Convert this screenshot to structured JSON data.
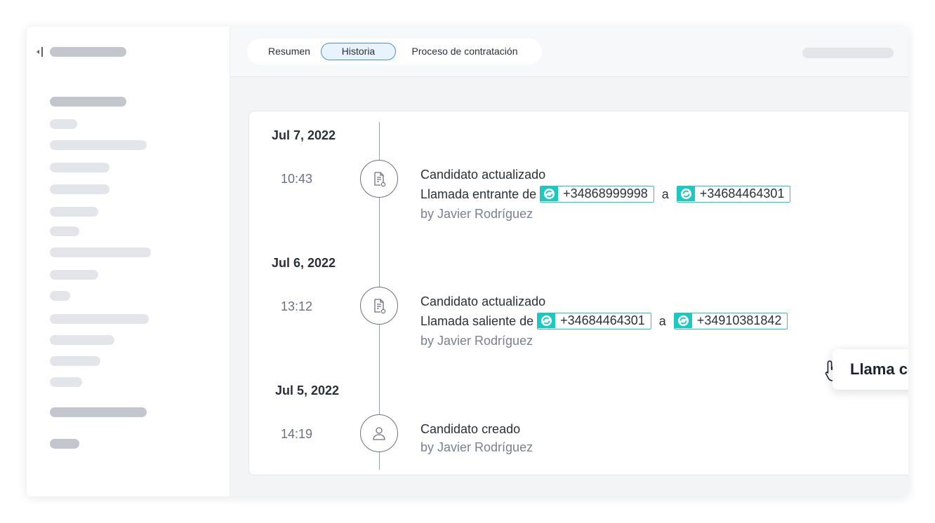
{
  "tabs": [
    {
      "label": "Resumen"
    },
    {
      "label": "Historia",
      "active": true
    },
    {
      "label": "Proceso de contratación"
    }
  ],
  "colors": {
    "accent": "#1ec8c1",
    "active_tab_border": "#4a90d9",
    "active_tab_bg": "#e8f3fd"
  },
  "icons": {
    "sidebar_toggle": "collapse-sidebar-icon",
    "update_node": "document-refresh-icon",
    "create_node": "user-icon",
    "chip": "ringover-sync-icon",
    "cursor": "hand-pointer-icon"
  },
  "timeline": [
    {
      "date": "Jul 7, 2022",
      "time": "10:43",
      "title": "Candidato actualizado",
      "call_text": "Llamada entrante de",
      "from": "+34868999998",
      "connector": "a",
      "to": "+34684464301",
      "author": "by Javier Rodríguez"
    },
    {
      "date": "Jul 6, 2022",
      "time": "13:12",
      "title": "Candidato actualizado",
      "call_text": "Llamada saliente de",
      "from": "+34684464301",
      "connector": "a",
      "to": "+34910381842",
      "author": "by Javier Rodríguez"
    },
    {
      "date": "Jul 5, 2022",
      "time": "14:19",
      "title": "Candidato creado",
      "author": "by Javier Rodríguez"
    }
  ],
  "tooltip": {
    "label": "Llama con Ringover"
  }
}
